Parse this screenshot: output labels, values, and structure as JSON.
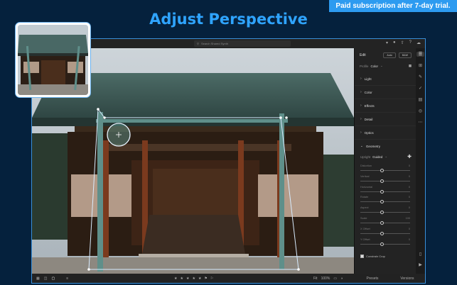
{
  "promo": {
    "text": "Paid subscription after 7-day trial."
  },
  "headline": {
    "text": "Adjust Perspective"
  },
  "search": {
    "placeholder": "Search Shared Synth"
  },
  "panel": {
    "title": "Edit",
    "auto_label": "Auto",
    "bw_label": "B&W",
    "profile_label": "Profile",
    "profile_value": "Color",
    "sections": [
      "Light",
      "Color",
      "Effects",
      "Detail",
      "Optics"
    ],
    "geometry": {
      "title": "Geometry",
      "upright_label": "Upright",
      "upright_value": "Guided",
      "sliders": [
        {
          "label": "Distortion",
          "value": "0"
        },
        {
          "label": "Vertical",
          "value": "0"
        },
        {
          "label": "Horizontal",
          "value": "0"
        },
        {
          "label": "Rotate",
          "value": "0"
        },
        {
          "label": "Aspect",
          "value": "0"
        },
        {
          "label": "Scale",
          "value": "100"
        },
        {
          "label": "X Offset",
          "value": "0"
        },
        {
          "label": "Y Offset",
          "value": "0"
        }
      ],
      "constrain_label": "Constrain Crop"
    }
  },
  "bottombar": {
    "zoom_fit": "Fit",
    "zoom_pct": "100%",
    "presets": "Presets",
    "versions": "Versions"
  },
  "colors": {
    "accent": "#2fa4ff",
    "banner": "#2d9bf0",
    "guide": "#6cb3ef"
  }
}
